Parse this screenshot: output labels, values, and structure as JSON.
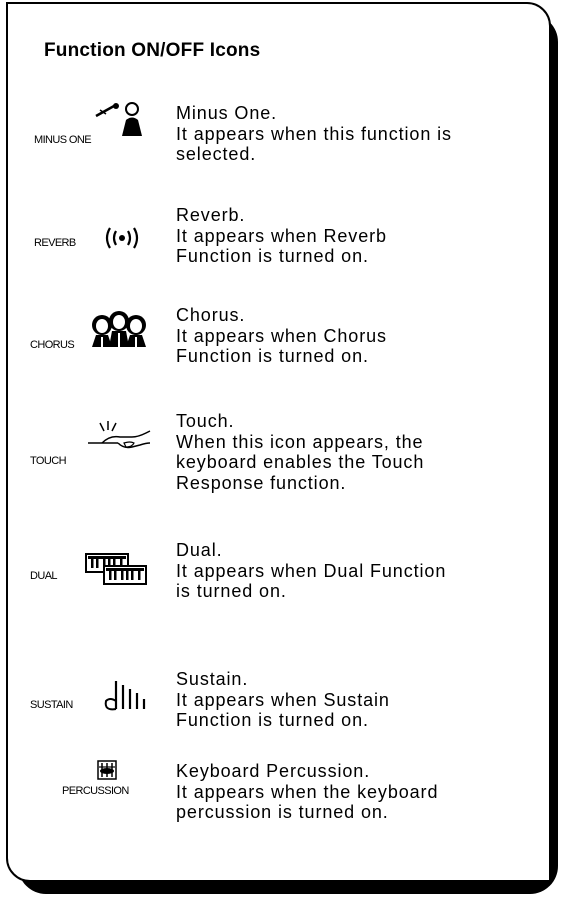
{
  "title": "Function ON/OFF Icons",
  "entries": [
    {
      "label": "MINUS ONE",
      "icon": "minus-one-icon",
      "text": "Minus One.\nIt appears when this function is\nselected."
    },
    {
      "label": "REVERB",
      "icon": "reverb-icon",
      "text": "Reverb.\n It appears when Reverb\nFunction is turned on."
    },
    {
      "label": "CHORUS",
      "icon": "chorus-icon",
      "text": "Chorus.\n It appears when Chorus\nFunction is turned on."
    },
    {
      "label": "TOUCH",
      "icon": "touch-icon",
      "text": "Touch.\n When this icon appears, the\nkeyboard enables the Touch\nResponse function."
    },
    {
      "label": "DUAL",
      "icon": "dual-icon",
      "text": "Dual.\nIt appears when Dual Function\nis turned on."
    },
    {
      "label": "SUSTAIN",
      "icon": "sustain-icon",
      "text": "Sustain.\nIt appears when Sustain\nFunction is turned on."
    },
    {
      "label": "PERCUSSION",
      "icon": "percussion-icon",
      "text": "Keyboard Percussion.\nIt appears when the keyboard\npercussion is turned on."
    }
  ]
}
